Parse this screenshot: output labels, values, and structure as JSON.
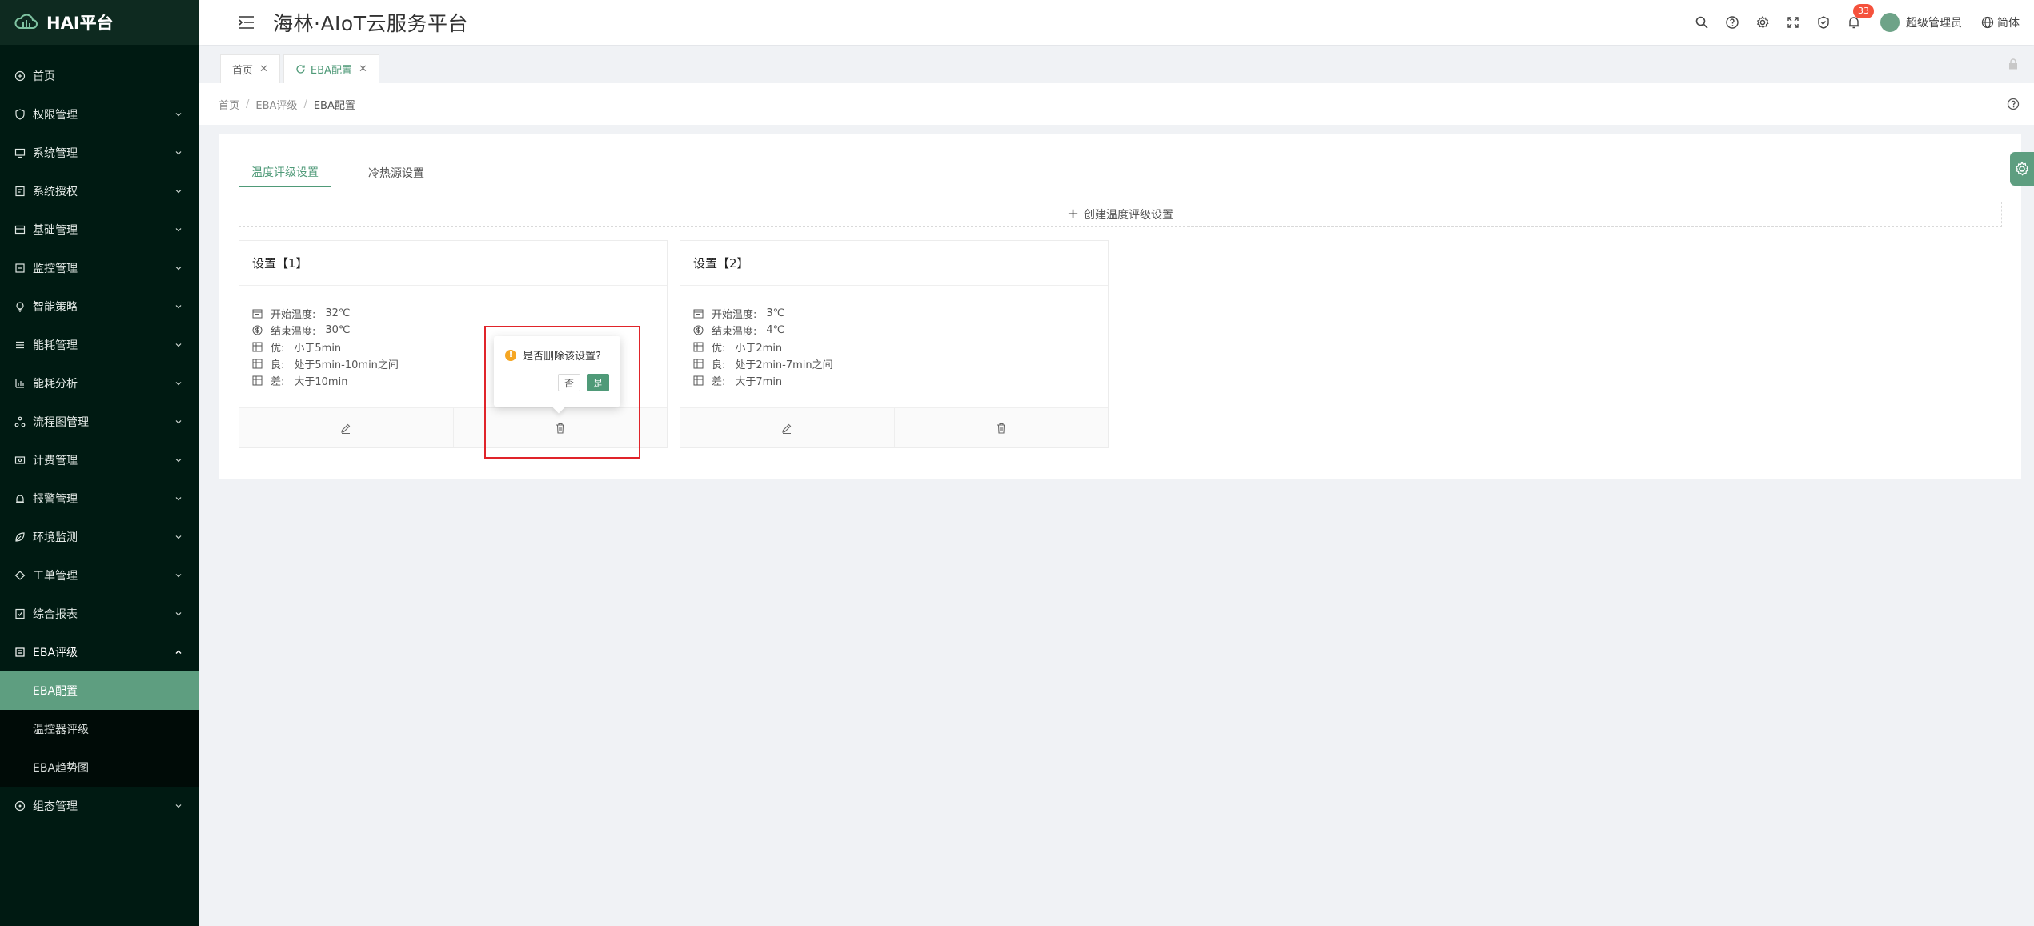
{
  "brand": {
    "name": "HAI平台"
  },
  "header": {
    "title": "海林·AIoT云服务平台",
    "notifications": "33",
    "user": "超级管理员",
    "lang": "简体"
  },
  "sidebar": {
    "items": [
      {
        "label": "首页",
        "icon": "home-icon"
      },
      {
        "label": "权限管理",
        "icon": "shield-icon"
      },
      {
        "label": "系统管理",
        "icon": "monitor-icon"
      },
      {
        "label": "系统授权",
        "icon": "auth-icon"
      },
      {
        "label": "基础管理",
        "icon": "box-icon"
      },
      {
        "label": "监控管理",
        "icon": "monitor-icon"
      },
      {
        "label": "智能策略",
        "icon": "bulb-icon"
      },
      {
        "label": "能耗管理",
        "icon": "list-icon"
      },
      {
        "label": "能耗分析",
        "icon": "chart-icon"
      },
      {
        "label": "流程图管理",
        "icon": "flow-icon"
      },
      {
        "label": "计费管理",
        "icon": "bill-icon"
      },
      {
        "label": "报警管理",
        "icon": "alarm-icon"
      },
      {
        "label": "环境监测",
        "icon": "leaf-icon"
      },
      {
        "label": "工单管理",
        "icon": "ticket-icon"
      },
      {
        "label": "综合报表",
        "icon": "report-icon"
      },
      {
        "label": "EBA评级",
        "icon": "eba-icon"
      }
    ],
    "eba_sub": [
      {
        "label": "EBA配置"
      },
      {
        "label": "温控器评级"
      },
      {
        "label": "EBA趋势图"
      }
    ],
    "last": {
      "label": "组态管理",
      "icon": "config-icon"
    }
  },
  "pagetabs": {
    "home": "首页",
    "current": "EBA配置"
  },
  "breadcrumb": {
    "a": "首页",
    "b": "EBA评级",
    "c": "EBA配置"
  },
  "tabs": {
    "t1": "温度评级设置",
    "t2": "冷热源设置"
  },
  "create": "创建温度评级设置",
  "cards": [
    {
      "title": "设置【1】",
      "rows": [
        {
          "k": "开始温度:",
          "v": "32℃"
        },
        {
          "k": "结束温度:",
          "v": "30℃"
        },
        {
          "k": "优:",
          "v": "小于5min"
        },
        {
          "k": "良:",
          "v": "处于5min-10min之间"
        },
        {
          "k": "差:",
          "v": "大于10min"
        }
      ]
    },
    {
      "title": "设置【2】",
      "rows": [
        {
          "k": "开始温度:",
          "v": "3℃"
        },
        {
          "k": "结束温度:",
          "v": "4℃"
        },
        {
          "k": "优:",
          "v": "小于2min"
        },
        {
          "k": "良:",
          "v": "处于2min-7min之间"
        },
        {
          "k": "差:",
          "v": "大于7min"
        }
      ]
    }
  ],
  "popconfirm": {
    "message": "是否删除该设置?",
    "no": "否",
    "yes": "是"
  },
  "colors": {
    "accent": "#4f9a78",
    "sidebar": "#001a12",
    "active_menu": "#5e9e80",
    "badge": "#f5523c",
    "highlight": "#e0242a"
  }
}
